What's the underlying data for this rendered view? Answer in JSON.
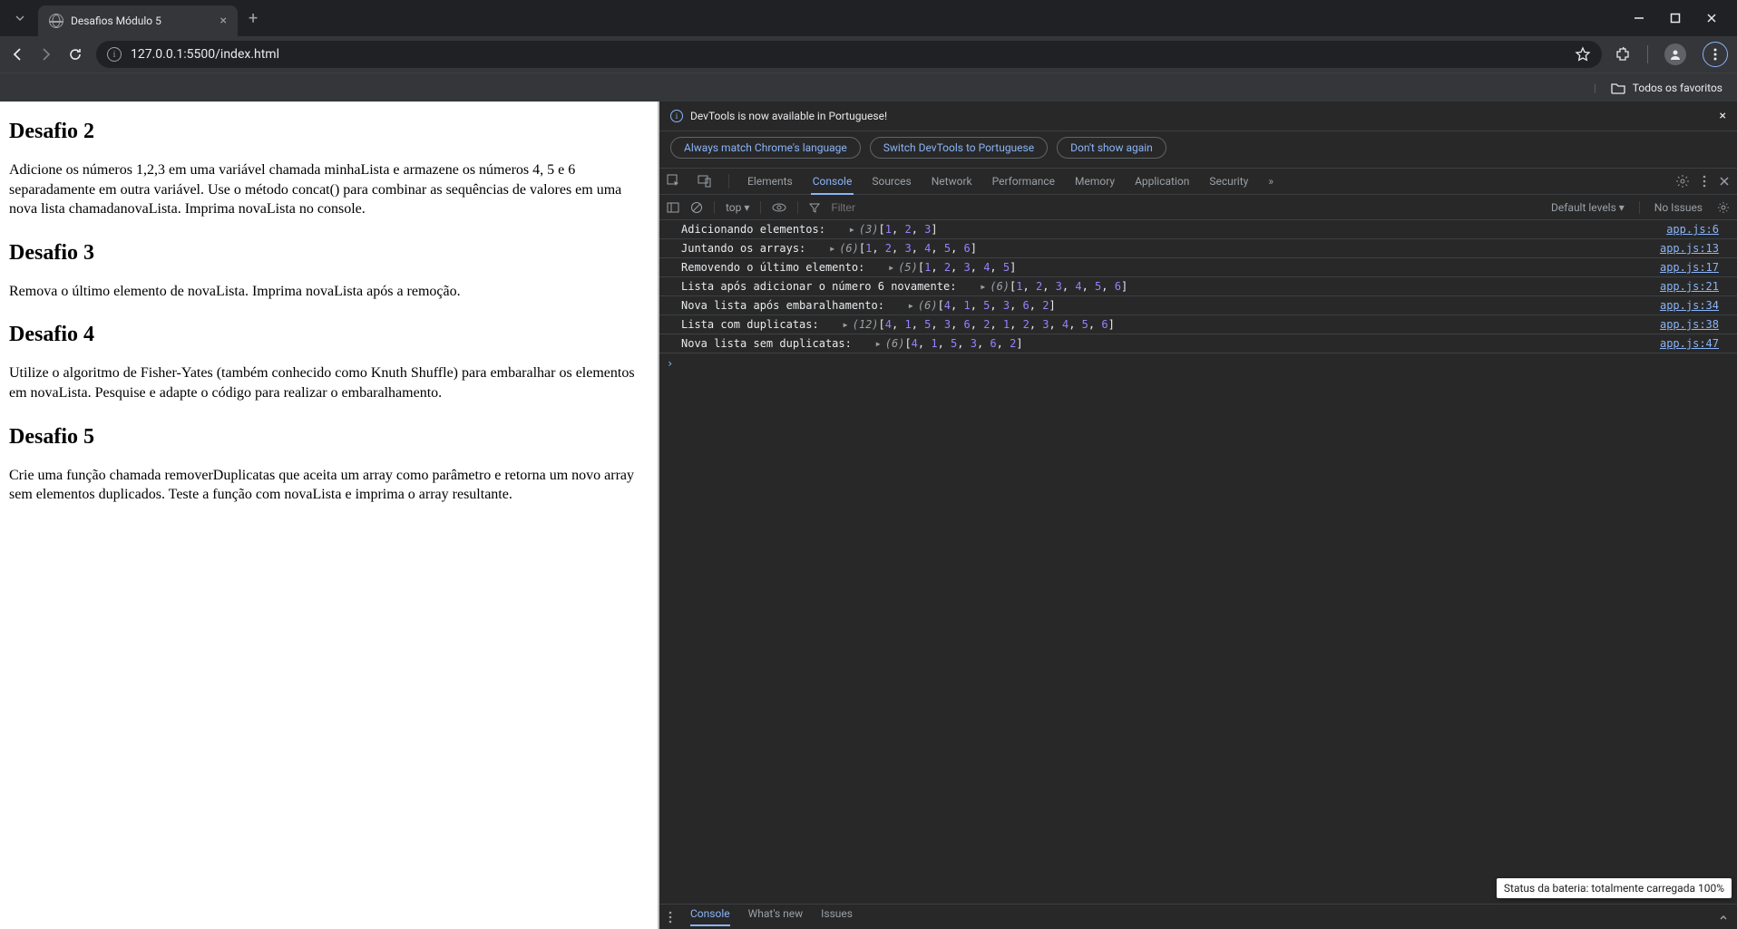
{
  "browser": {
    "tab_title": "Desafios Módulo 5",
    "url": "127.0.0.1:5500/index.html",
    "bookmarks_label": "Todos os favoritos"
  },
  "page": {
    "sections": [
      {
        "heading": "Desafio 2",
        "body": "Adicione os números 1,2,3 em uma variável chamada minhaLista e armazene os números 4, 5 e 6 separadamente em outra variável. Use o método concat() para combinar as sequências de valores em uma nova lista chamadanovaLista. Imprima novaLista no console."
      },
      {
        "heading": "Desafio 3",
        "body": "Remova o último elemento de novaLista. Imprima novaLista após a remoção."
      },
      {
        "heading": "Desafio 4",
        "body": "Utilize o algoritmo de Fisher-Yates (também conhecido como Knuth Shuffle) para embaralhar os elementos em novaLista. Pesquise e adapte o código para realizar o embaralhamento."
      },
      {
        "heading": "Desafio 5",
        "body": "Crie uma função chamada removerDuplicatas que aceita um array como parâmetro e retorna um novo array sem elementos duplicados. Teste a função com novaLista e imprima o array resultante."
      }
    ]
  },
  "devtools": {
    "banner_text": "DevTools is now available in Portuguese!",
    "banner_buttons": {
      "always": "Always match Chrome's language",
      "switch": "Switch DevTools to Portuguese",
      "dont": "Don't show again"
    },
    "tabs": [
      "Elements",
      "Console",
      "Sources",
      "Network",
      "Performance",
      "Memory",
      "Application",
      "Security"
    ],
    "active_tab": "Console",
    "console_toolbar": {
      "context": "top",
      "filter_placeholder": "Filter",
      "levels": "Default levels",
      "issues": "No Issues"
    },
    "console_logs": [
      {
        "label": "Adicionando elementos:",
        "count": 3,
        "values": [
          1,
          2,
          3
        ],
        "link": "app.js:6"
      },
      {
        "label": "Juntando os arrays:",
        "count": 6,
        "values": [
          1,
          2,
          3,
          4,
          5,
          6
        ],
        "link": "app.js:13"
      },
      {
        "label": "Removendo o último elemento:",
        "count": 5,
        "values": [
          1,
          2,
          3,
          4,
          5
        ],
        "link": "app.js:17"
      },
      {
        "label": "Lista após adicionar o número 6 novamente:",
        "count": 6,
        "values": [
          1,
          2,
          3,
          4,
          5,
          6
        ],
        "link": "app.js:21"
      },
      {
        "label": "Nova lista após embaralhamento:",
        "count": 6,
        "values": [
          4,
          1,
          5,
          3,
          6,
          2
        ],
        "link": "app.js:34"
      },
      {
        "label": "Lista com duplicatas:",
        "count": 12,
        "values": [
          4,
          1,
          5,
          3,
          6,
          2,
          1,
          2,
          3,
          4,
          5,
          6
        ],
        "link": "app.js:38"
      },
      {
        "label": "Nova lista sem duplicatas:",
        "count": 6,
        "values": [
          4,
          1,
          5,
          3,
          6,
          2
        ],
        "link": "app.js:47"
      }
    ],
    "drawer_tabs": [
      "Console",
      "What's new",
      "Issues"
    ]
  },
  "tooltip": {
    "battery": "Status da bateria: totalmente carregada 100%"
  }
}
